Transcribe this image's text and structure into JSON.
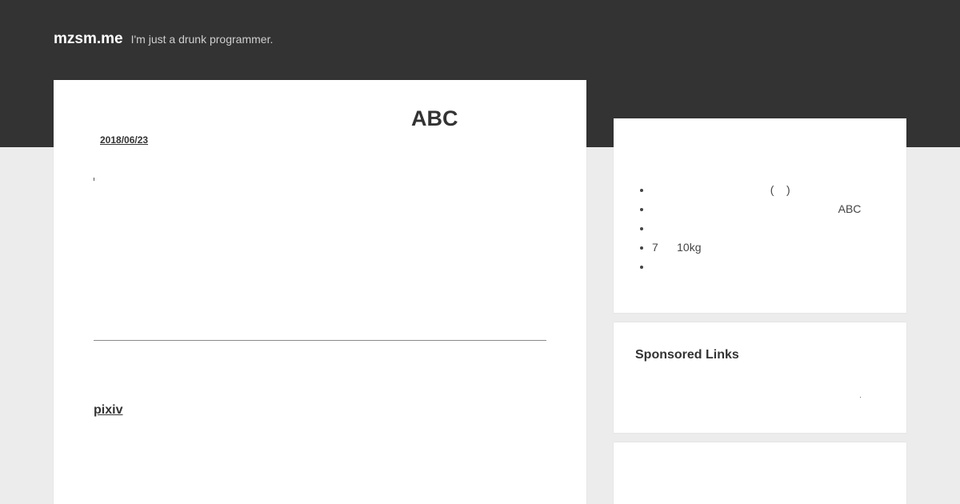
{
  "header": {
    "site_title": "mzsm.me",
    "tagline": "I'm just a drunk programmer."
  },
  "article": {
    "title": "ABC",
    "date": "2018/06/23",
    "link_label": "pixiv"
  },
  "sidebar": {
    "recent_posts": [
      {
        "label": "                                      (    )"
      },
      {
        "label": "                                                            ABC"
      },
      {
        "label": ""
      },
      {
        "label": "7      10kg"
      },
      {
        "label": ""
      }
    ],
    "sponsored_heading": "Sponsored Links"
  },
  "colors": {
    "header_background": "#333333",
    "page_background": "#ececec",
    "card_background": "#ffffff",
    "text": "#333333"
  }
}
